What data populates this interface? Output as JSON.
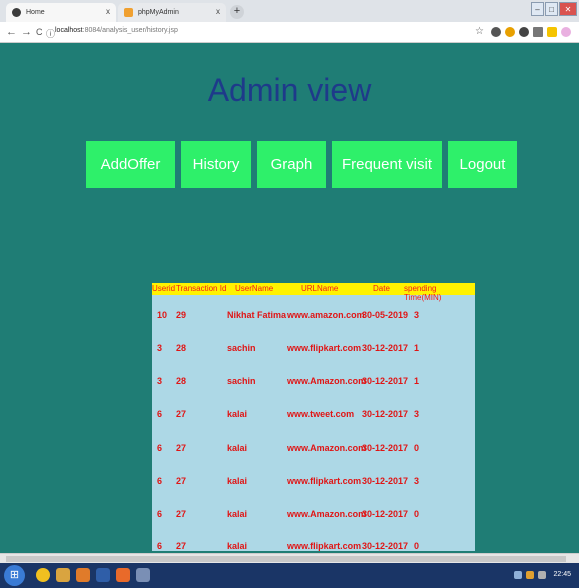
{
  "browser": {
    "tabs": [
      {
        "title": "Home"
      },
      {
        "title": "phpMyAdmin"
      }
    ],
    "tab_close": "x",
    "new_tab": "+",
    "nav": {
      "back": "←",
      "forward": "→",
      "reload": "C",
      "info": "ⓘ"
    },
    "url_host": "localhost",
    "url_path": ":8084/analysis_user/history.jsp",
    "star": "☆"
  },
  "page": {
    "title": "Admin view",
    "menu": [
      "AddOffer",
      "History",
      "Graph",
      "Frequent visit",
      "Logout"
    ]
  },
  "table": {
    "headers": [
      "Userid",
      "Transaction Id",
      "UserName",
      "URLName",
      "Date",
      "spending Time(MIN)"
    ],
    "rows": [
      [
        "10",
        "29",
        "Nikhat Fatima",
        "www.amazon.com",
        "30-05-2019",
        "3"
      ],
      [
        "3",
        "28",
        "sachin",
        "www.flipkart.com",
        "30-12-2017",
        "1"
      ],
      [
        "3",
        "28",
        "sachin",
        "www.Amazon.com",
        "30-12-2017",
        "1"
      ],
      [
        "6",
        "27",
        "kalai",
        "www.tweet.com",
        "30-12-2017",
        "3"
      ],
      [
        "6",
        "27",
        "kalai",
        "www.Amazon.com",
        "30-12-2017",
        "0"
      ],
      [
        "6",
        "27",
        "kalai",
        "www.flipkart.com",
        "30-12-2017",
        "3"
      ],
      [
        "6",
        "27",
        "kalai",
        "www.Amazon.com",
        "30-12-2017",
        "0"
      ],
      [
        "6",
        "27",
        "kalai",
        "www.flipkart.com",
        "30-12-2017",
        "0"
      ]
    ]
  },
  "taskbar": {
    "clock": "22:45",
    "start": "⊞"
  }
}
